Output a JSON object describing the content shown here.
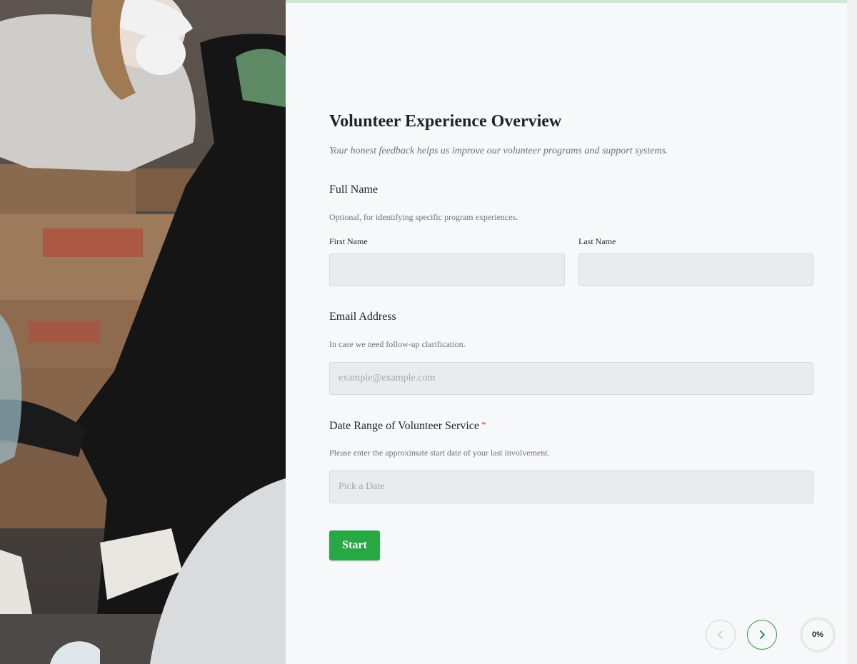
{
  "form": {
    "title": "Volunteer Experience Overview",
    "subtitle": "Your honest feedback helps us improve our volunteer programs and support systems."
  },
  "full_name": {
    "label": "Full Name",
    "description": "Optional, for identifying specific program experiences.",
    "first_label": "First Name",
    "last_label": "Last Name",
    "first_value": "",
    "last_value": ""
  },
  "email": {
    "label": "Email Address",
    "description": "In case we need follow-up clarification.",
    "placeholder": "example@example.com",
    "value": ""
  },
  "date_range": {
    "label": "Date Range of Volunteer Service",
    "required_marker": "*",
    "description": "Please enter the approximate start date of your last involvement.",
    "placeholder": "Pick a Date",
    "value": ""
  },
  "actions": {
    "start_label": "Start"
  },
  "navigation": {
    "prev_icon": "chevron-left-icon",
    "next_icon": "chevron-right-icon"
  },
  "progress": {
    "value": 0,
    "label": "0%"
  },
  "colors": {
    "accent": "#28a745",
    "required": "#e0413b"
  }
}
